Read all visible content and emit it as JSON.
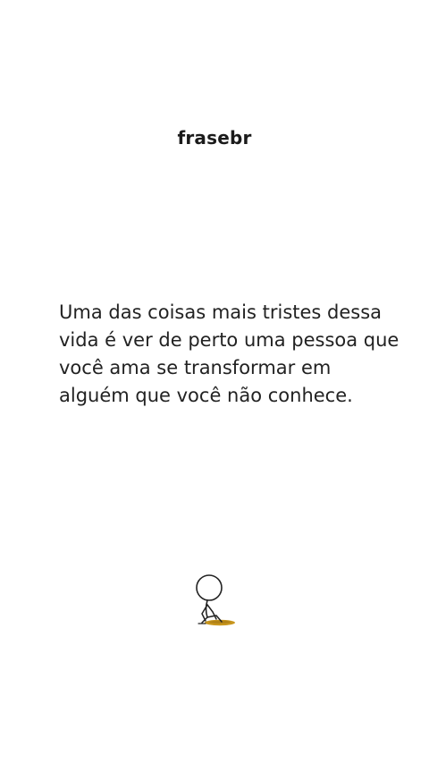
{
  "brand": {
    "name": "frasebr"
  },
  "quote": {
    "lines": [
      "Uma das coisas mais tristes dessa",
      "vida é ver de perto uma pessoa que",
      "você ama se transformar em",
      "alguém que você não conhece."
    ]
  },
  "illustration": {
    "icon": "sad-stick-figure-icon",
    "hole_color": "#c8961e"
  }
}
